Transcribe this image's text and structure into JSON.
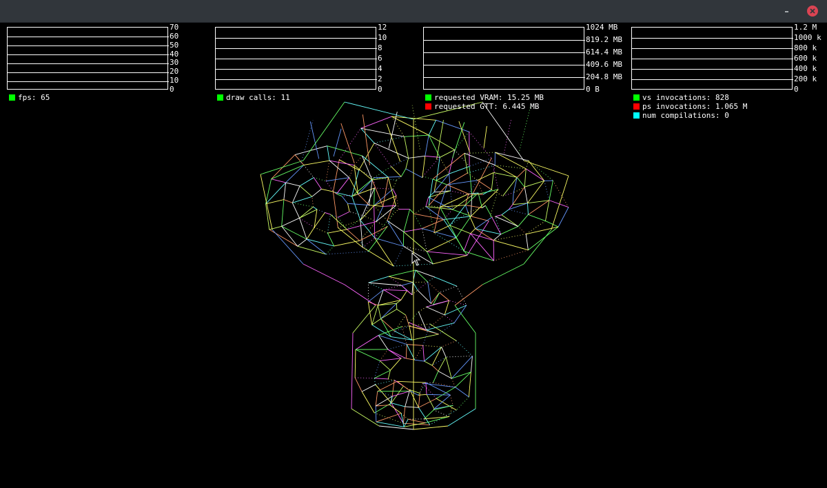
{
  "window": {
    "close_icon_color": "#da4453",
    "titlebar_color": "#31363b"
  },
  "hud": {
    "fps": {
      "ticks": [
        "70",
        "60",
        "50",
        "40",
        "30",
        "20",
        "10",
        "0"
      ],
      "legend": [
        {
          "label": "fps: 65",
          "color": "#00ff00"
        }
      ]
    },
    "draw_calls": {
      "ticks": [
        "12",
        "10",
        "8",
        "6",
        "4",
        "2",
        "0"
      ],
      "legend": [
        {
          "label": "draw calls: 11",
          "color": "#00ff00"
        }
      ]
    },
    "memory": {
      "ticks": [
        "1024 MB",
        "819.2 MB",
        "614.4 MB",
        "409.6 MB",
        "204.8 MB",
        "0 B"
      ],
      "legend": [
        {
          "label": "requested VRAM: 15.25 MB",
          "color": "#00ff00"
        },
        {
          "label": "requested GTT: 6.445 MB",
          "color": "#ff0000"
        }
      ]
    },
    "invocations": {
      "ticks": [
        "1.2 M",
        "1000 k",
        "800 k",
        "600 k",
        "400 k",
        "200 k",
        "0"
      ],
      "legend": [
        {
          "label": "vs invocations: 828",
          "color": "#00ff00"
        },
        {
          "label": "ps invocations: 1.065 M",
          "color": "#ff0000"
        },
        {
          "label": "num compilations: 0",
          "color": "#00ffff"
        }
      ]
    }
  },
  "scene": {
    "mesh_colors": [
      "#ffff66",
      "#66ff66",
      "#ff66ff",
      "#6699ff",
      "#66ffff",
      "#ffffff",
      "#ff9966",
      "#ccff66"
    ]
  }
}
